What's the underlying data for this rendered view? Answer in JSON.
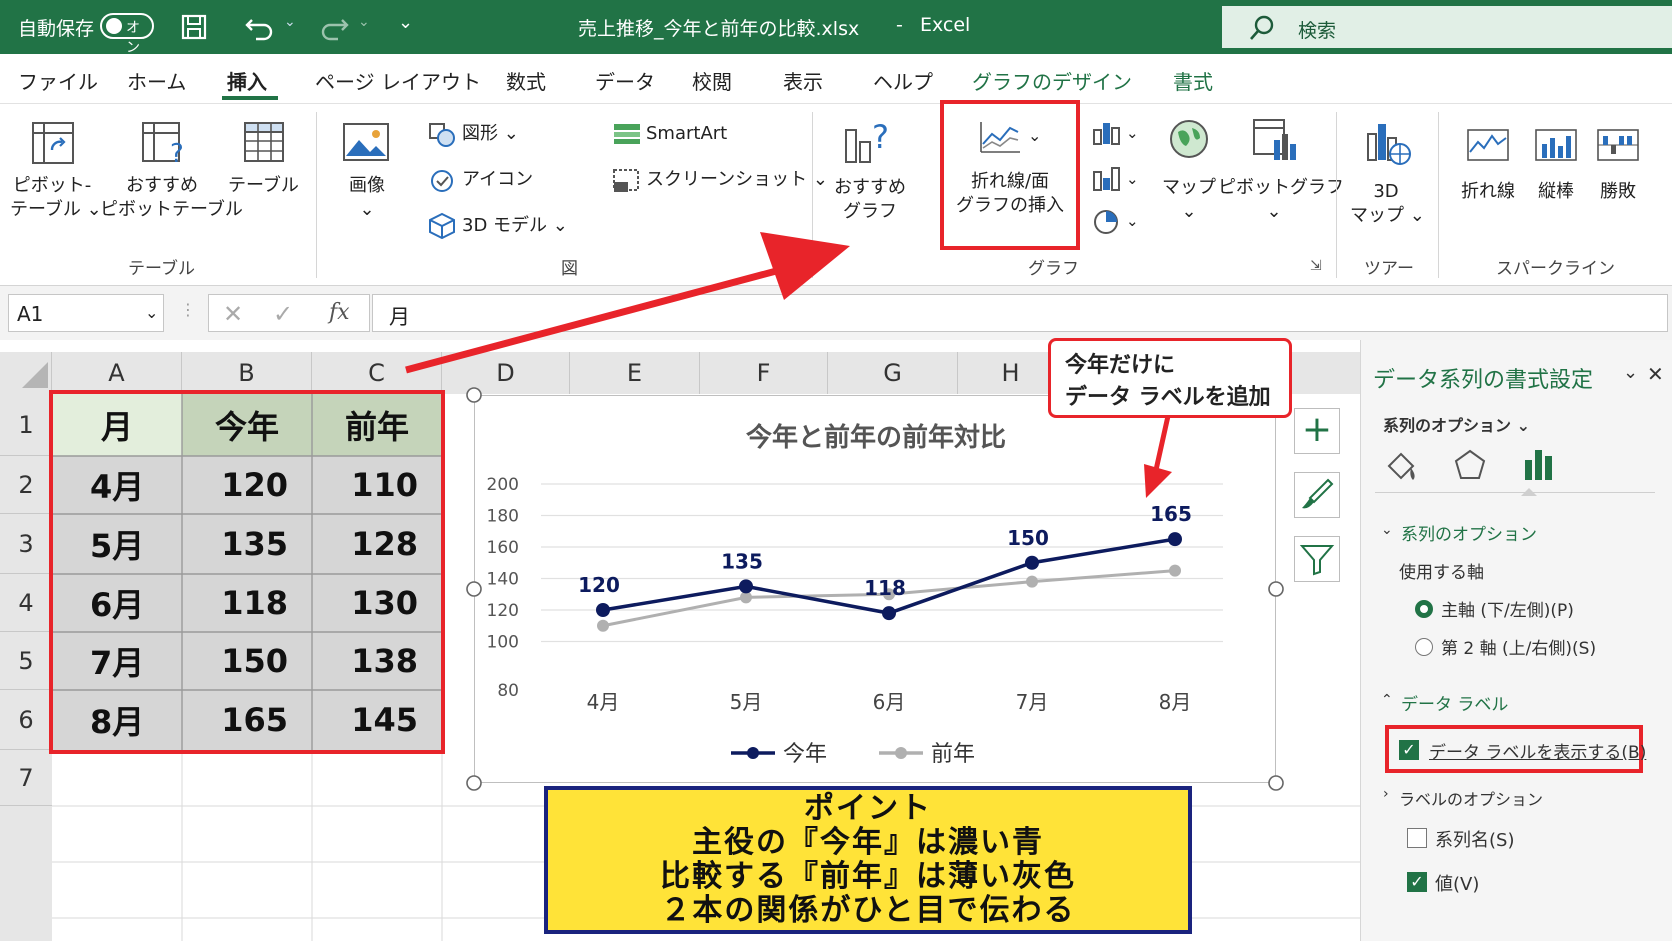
{
  "title_bar": {
    "autosave_label": "自動保存",
    "autosave_toggle": "オン",
    "file_name": "売上推移_今年と前年の比較.xlsx",
    "separator": "-",
    "app_name": "Excel",
    "search_placeholder": "検索"
  },
  "menu_tabs": [
    "ファイル",
    "ホーム",
    "挿入",
    "ページ レイアウト",
    "数式",
    "データ",
    "校閲",
    "表示",
    "ヘルプ",
    "グラフのデザイン",
    "書式"
  ],
  "active_tab": "挿入",
  "ribbon": {
    "pivot_table": [
      "ピボット-",
      "テーブル ⌄"
    ],
    "recommended_pivot": [
      "おすすめ",
      "ピボットテーブル"
    ],
    "table": "テーブル",
    "group_table": "テーブル",
    "picture": "画像",
    "shapes": "図形 ⌄",
    "icons": "アイコン",
    "model_3d": "3D モデル ⌄",
    "smartart": "SmartArt",
    "screenshot": "スクリーンショット ⌄",
    "group_illust": "図",
    "recommended_chart": [
      "おすすめ",
      "グラフ"
    ],
    "line_chart": [
      "折れ線/面",
      "グラフの挿入"
    ],
    "maps": "マップ",
    "pivot_chart": "ピボットグラフ",
    "group_chart": "グラフ",
    "map_3d": [
      "3D",
      "マップ ⌄"
    ],
    "group_tour": "ツアー",
    "spark_line": "折れ線",
    "spark_column": "縦棒",
    "spark_winloss": "勝敗",
    "group_sparkline": "スパークライン"
  },
  "formula_bar": {
    "name_box": "A1",
    "fx": "fx",
    "value": "月"
  },
  "columns": [
    "A",
    "B",
    "C",
    "D",
    "E",
    "F",
    "G",
    "H"
  ],
  "rows": [
    "1",
    "2",
    "3",
    "4",
    "5",
    "6",
    "7"
  ],
  "table": {
    "header": [
      "月",
      "今年",
      "前年"
    ],
    "rows": [
      [
        "4月",
        "120",
        "110"
      ],
      [
        "5月",
        "135",
        "128"
      ],
      [
        "6月",
        "118",
        "130"
      ],
      [
        "7月",
        "150",
        "138"
      ],
      [
        "8月",
        "165",
        "145"
      ]
    ]
  },
  "chart_data": {
    "type": "line",
    "title": "今年と前年の前年対比",
    "categories": [
      "4月",
      "5月",
      "6月",
      "7月",
      "8月"
    ],
    "series": [
      {
        "name": "今年",
        "values": [
          120,
          135,
          118,
          150,
          165
        ],
        "color": "#0d1b5e",
        "labels": [
          "120",
          "135",
          "118",
          "150",
          "165"
        ]
      },
      {
        "name": "前年",
        "values": [
          110,
          128,
          130,
          138,
          145
        ],
        "color": "#b0b0b0"
      }
    ],
    "y_ticks": [
      "200",
      "180",
      "160",
      "140",
      "120",
      "100",
      "80"
    ],
    "ylim": [
      80,
      200
    ],
    "legend": "bottom",
    "grid": true
  },
  "callout": [
    "今年だけに",
    "データ ラベルを追加"
  ],
  "note": [
    "ポイント",
    "主役の『今年』は濃い青",
    "比較する『前年』は薄い灰色",
    "２本の関係がひと目で伝わる"
  ],
  "pane": {
    "title": "データ系列の書式設定",
    "series_options_menu": "系列のオプション ⌄",
    "section_series": "系列のオプション",
    "axis_label": "使用する軸",
    "axis_primary": "主軸 (下/左側)(P)",
    "axis_secondary": "第 2 軸 (上/右側)(S)",
    "section_labels": "データ ラベル",
    "show_labels": "データ ラベルを表示する(B)",
    "label_options": "ラベルのオプション",
    "opt_series_name": "系列名(S)",
    "opt_value": "値(V)"
  },
  "colors": {
    "excel_green": "#217346",
    "highlight_red": "#e8242a",
    "series_this_year": "#0d1b5e",
    "series_last_year": "#b0b0b0",
    "note_bg": "#ffe338",
    "note_border": "#1a237e"
  }
}
